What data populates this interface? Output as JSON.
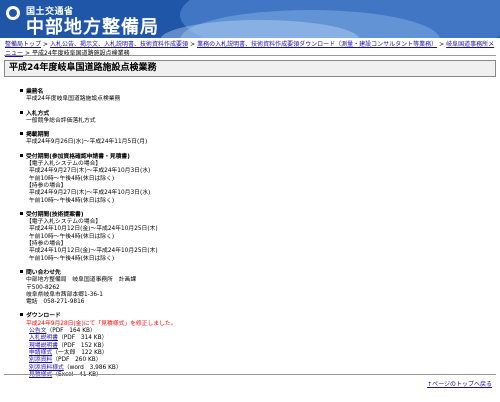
{
  "header": {
    "agency": "国土交通省",
    "bureau": "中部地方整備局"
  },
  "breadcrumb": [
    "整備局トップ",
    "入札公告、掲示文、入札説明書、技術資料作成要領",
    "業務の入札説明書、技術資料作成要領ダウンロード（測量・建設コンサルタント等業務）",
    "岐阜国道事務所メニュー",
    "平成24年度岐阜国道路施設点検業務"
  ],
  "page_title": "平成24年度岐阜国道路施設点検業務",
  "sections": {
    "name": {
      "head": "業務名",
      "lines": [
        "平成24年度岐阜国道路施設点検業務"
      ]
    },
    "method": {
      "head": "入札方式",
      "lines": [
        "一般競争総合評価落札方式"
      ]
    },
    "period": {
      "head": "掲載期間",
      "lines": [
        "平成24年9月26日(水)〜平成24年11月5日(月)"
      ]
    },
    "apply": {
      "head": "受付期間(参加資格確認申請書・見積書)",
      "lines": [
        "【電子入札システムの場合】",
        "平成24年9月27日(木)〜平成24年10月3日(水)",
        "午前10時〜午後4時(休日は除く)",
        "【持参の場合】",
        "平成24年9月27日(木)〜平成24年10月3日(水)",
        "午前10時〜午後4時(休日は除く)"
      ]
    },
    "proposal": {
      "head": "受付期間(技術提案書)",
      "lines": [
        "【電子入札システムの場合】",
        "平成24年10月12日(金)〜平成24年10月25日(木)",
        "午前10時〜午後4時(休日は除く)",
        "【持参の場合】",
        "平成24年10月12日(金)〜平成24年10月25日(木)",
        "午前10時〜午後4時(休日は除く)"
      ]
    },
    "contact": {
      "head": "問い合わせ先",
      "lines": [
        "中部地方整備局　岐阜国道事務所　計画課",
        "〒500-8262",
        "岐阜県岐阜市茜部本郷1-36-1",
        "電話　058-271-9816"
      ]
    },
    "download": {
      "head": "ダウンロード",
      "notice": "平成24年9月28日(金)にて「見積様式」を修正しました。",
      "files": [
        {
          "label": "公告文",
          "info": "（PDF　164 KB）"
        },
        {
          "label": "入札説明書",
          "info": "（PDF　314 KB）"
        },
        {
          "label": "現場説明書",
          "info": "（PDF　152 KB）"
        },
        {
          "label": "申請様式",
          "info": "（一太郎　122 KB）"
        },
        {
          "label": "別添資料",
          "info": "（PDF　260 KB）"
        },
        {
          "label": "別添資料様式",
          "info": "（word　3,986 KB）"
        },
        {
          "label": "見積様式",
          "info": "（Excel　41 KB）"
        }
      ]
    }
  },
  "footer": {
    "back_to_top": "↑ページのトップへ戻る"
  }
}
